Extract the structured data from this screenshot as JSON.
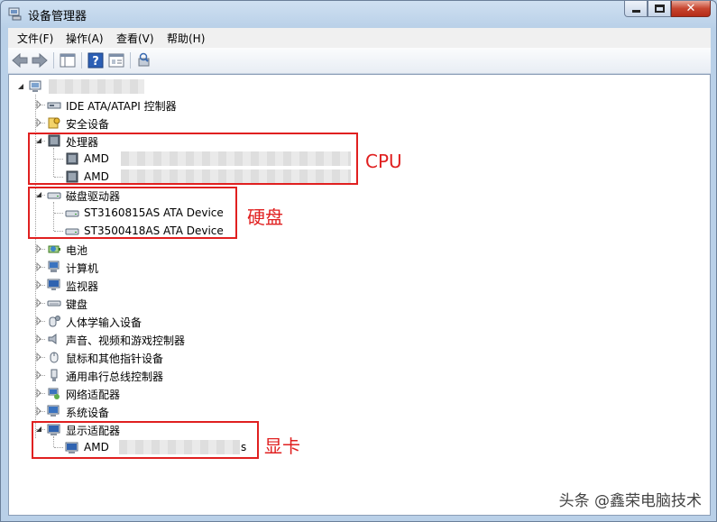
{
  "window": {
    "title": "设备管理器",
    "close_glyph": "✕"
  },
  "menu": [
    "文件(F)",
    "操作(A)",
    "查看(V)",
    "帮助(H)"
  ],
  "tree": {
    "root": "",
    "categories": [
      {
        "label": "IDE ATA/ATAPI 控制器",
        "icon": "ide-controller-icon",
        "expanded": false
      },
      {
        "label": "安全设备",
        "icon": "security-device-icon",
        "expanded": false
      },
      {
        "label": "处理器",
        "icon": "processor-icon",
        "expanded": true,
        "children": [
          "AMD",
          "AMD"
        ]
      },
      {
        "label": "磁盘驱动器",
        "icon": "disk-drive-icon",
        "expanded": true,
        "children": [
          "ST3160815AS ATA Device",
          "ST3500418AS ATA Device"
        ]
      },
      {
        "label": "电池",
        "icon": "battery-icon",
        "expanded": false
      },
      {
        "label": "计算机",
        "icon": "computer-icon",
        "expanded": false
      },
      {
        "label": "监视器",
        "icon": "monitor-icon",
        "expanded": false
      },
      {
        "label": "键盘",
        "icon": "keyboard-icon",
        "expanded": false
      },
      {
        "label": "人体学输入设备",
        "icon": "hid-icon",
        "expanded": false
      },
      {
        "label": "声音、视频和游戏控制器",
        "icon": "sound-icon",
        "expanded": false
      },
      {
        "label": "鼠标和其他指针设备",
        "icon": "mouse-icon",
        "expanded": false
      },
      {
        "label": "通用串行总线控制器",
        "icon": "usb-icon",
        "expanded": false
      },
      {
        "label": "网络适配器",
        "icon": "network-adapter-icon",
        "expanded": false
      },
      {
        "label": "系统设备",
        "icon": "system-device-icon",
        "expanded": false
      },
      {
        "label": "显示适配器",
        "icon": "display-adapter-icon",
        "expanded": true,
        "children": [
          "AMD"
        ]
      }
    ],
    "display_child_suffix": "s"
  },
  "annotations": {
    "cpu": "CPU",
    "disk": "硬盘",
    "gpu": "显卡",
    "highlight_color": "#e02020"
  },
  "watermark": "头条 @鑫荣电脑技术"
}
